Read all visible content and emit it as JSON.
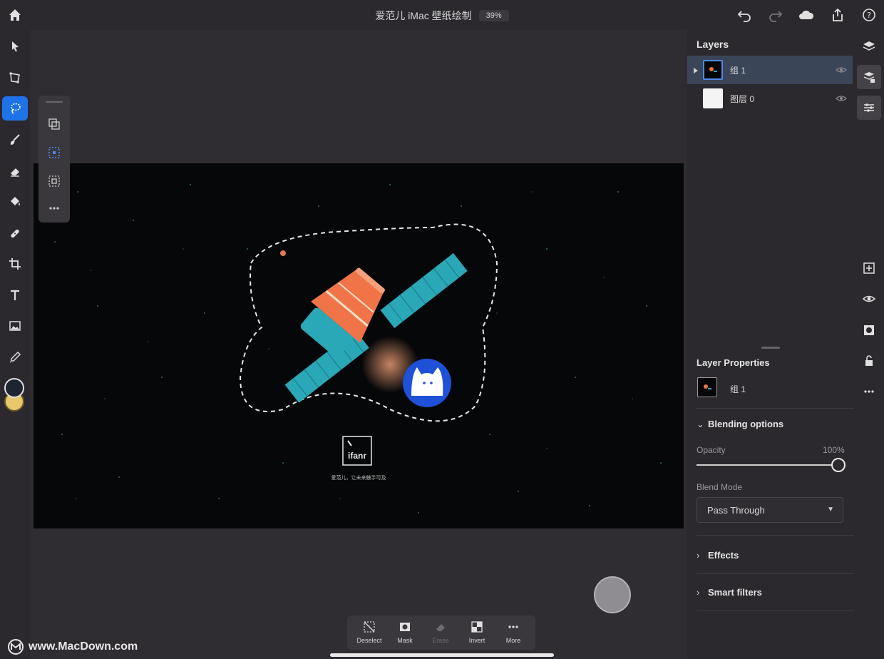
{
  "document": {
    "title": "爱范儿 iMac 壁纸绘制",
    "zoom": "39%"
  },
  "top_icons": [
    "home-icon",
    "undo-icon",
    "redo-icon",
    "cloud-icon",
    "share-icon",
    "help-icon"
  ],
  "left_tools": [
    {
      "name": "select-arrow-icon"
    },
    {
      "name": "transform-icon"
    },
    {
      "name": "lasso-select-icon",
      "active": true
    },
    {
      "name": "brush-icon"
    },
    {
      "name": "eraser-icon"
    },
    {
      "name": "fill-bucket-icon"
    },
    {
      "name": "healing-brush-icon"
    },
    {
      "name": "crop-icon"
    },
    {
      "name": "type-icon"
    },
    {
      "name": "place-image-icon"
    },
    {
      "name": "eyedropper-icon"
    }
  ],
  "colors": {
    "foreground": "#1c2530",
    "background": "#e8c86a",
    "accent": "#1f73e8"
  },
  "layers_panel": {
    "title": "Layers",
    "layers": [
      {
        "name": "组 1",
        "selected": true
      },
      {
        "name": "图层 0",
        "selected": false
      }
    ]
  },
  "layer_properties": {
    "title": "Layer Properties",
    "layer_name": "组 1",
    "blending": {
      "title": "Blending options",
      "opacity_label": "Opacity",
      "opacity_value": "100%",
      "opacity_fraction": 1.0,
      "blend_mode_label": "Blend Mode",
      "blend_mode_value": "Pass Through"
    },
    "effects_label": "Effects",
    "smart_filters_label": "Smart filters"
  },
  "artwork": {
    "logo_text": "ifanr",
    "caption": "爱范儿，让未来触手可及"
  },
  "actions": [
    {
      "label": "Deselect",
      "icon": "deselect-icon",
      "enabled": true
    },
    {
      "label": "Mask",
      "icon": "mask-icon",
      "enabled": true
    },
    {
      "label": "Erase",
      "icon": "erase-icon",
      "enabled": false
    },
    {
      "label": "Invert",
      "icon": "invert-icon",
      "enabled": true
    },
    {
      "label": "More",
      "icon": "more-icon",
      "enabled": true
    }
  ],
  "watermark": "www.MacDown.com"
}
